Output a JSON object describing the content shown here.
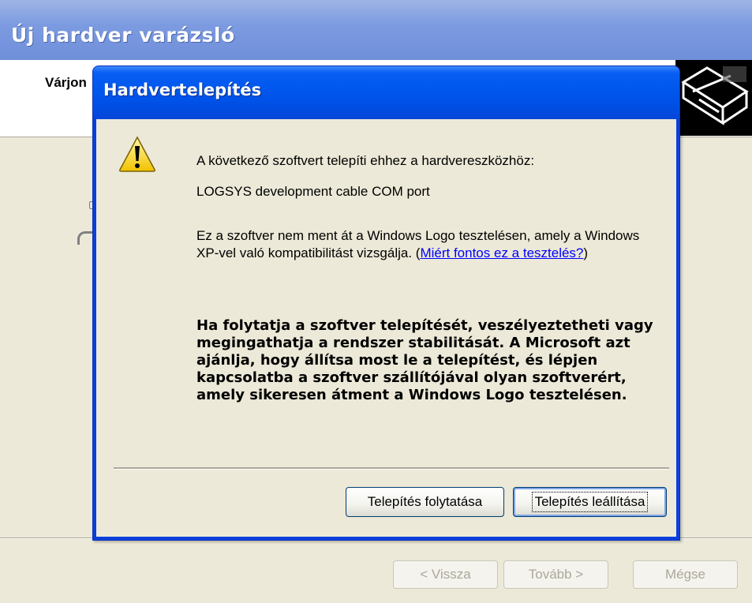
{
  "wizard": {
    "title": "Új hardver varázsló",
    "header_text": "Várjon",
    "buttons": {
      "back": "< Vissza",
      "next": "Tovább >",
      "cancel": "Mégse"
    }
  },
  "dialog": {
    "title": "Hardvertelepítés",
    "icon": "warning-icon",
    "line1": "A következő szoftvert telepíti ehhez a hardvereszközhöz:",
    "device_name": "LOGSYS development cable COM port",
    "paragraph_text": "Ez a szoftver nem ment át a Windows Logo tesztelésen, amely a Windows XP-vel való kompatibilitást vizsgálja. (",
    "paragraph_link": "Miért fontos ez a tesztelés?",
    "paragraph_close": ")",
    "warning_text": "Ha folytatja a szoftver telepítését, veszélyeztetheti vagy megingathatja a rendszer stabilitását. A Microsoft azt ajánlja, hogy állítsa most le a telepítést, és lépjen kapcsolatba a szoftver szállítójával olyan szoftverért, amely sikeresen átment a Windows Logo tesztelésen.",
    "buttons": {
      "continue": "Telepítés folytatása",
      "stop": "Telepítés leállítása"
    }
  },
  "colors": {
    "titlebar_blue": "#0058ee",
    "dialog_face": "#ece9d8",
    "link": "#0000ff"
  }
}
